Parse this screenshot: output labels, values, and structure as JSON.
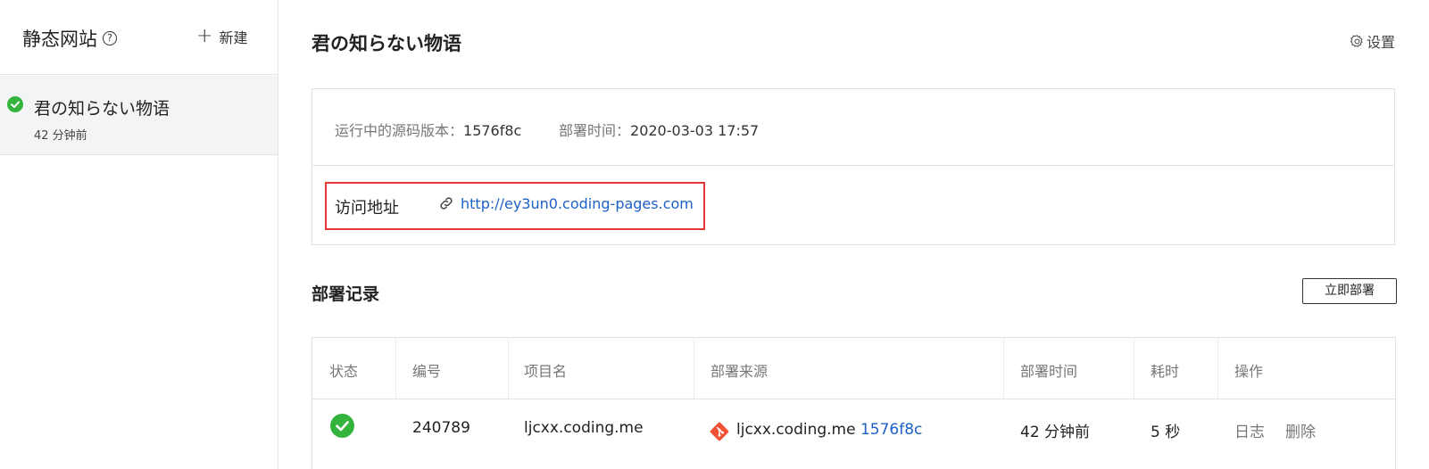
{
  "sidebar": {
    "title": "静态网站",
    "help_icon": "?",
    "new_label": "新建",
    "items": [
      {
        "name": "君の知らない物语",
        "time": "42 分钟前",
        "status": "success"
      }
    ]
  },
  "main": {
    "title": "君の知らない物语",
    "settings_label": "设置",
    "info": {
      "version_label": "运行中的源码版本：",
      "version": "1576f8c",
      "deploy_time_label": "部署时间：",
      "deploy_time": "2020-03-03 17:57",
      "url_label": "访问地址",
      "url": "http://ey3un0.coding-pages.com"
    },
    "records": {
      "title": "部署记录",
      "deploy_button": "立即部署",
      "columns": [
        "状态",
        "编号",
        "项目名",
        "部署来源",
        "部署时间",
        "耗时",
        "操作"
      ],
      "rows": [
        {
          "status": "success",
          "id": "240789",
          "project": "ljcxx.coding.me",
          "source_repo": "ljcxx.coding.me",
          "source_commit": "1576f8c",
          "time": "42 分钟前",
          "duration": "5 秒",
          "actions": [
            "日志",
            "删除"
          ]
        }
      ]
    }
  },
  "colors": {
    "success": "#35b43d",
    "link": "#1c60c9",
    "highlight": "#e53935",
    "git": "#f05033"
  },
  "icons": [
    "help-icon",
    "plus-icon",
    "check-circle-icon",
    "gear-icon",
    "link-icon",
    "git-icon"
  ]
}
